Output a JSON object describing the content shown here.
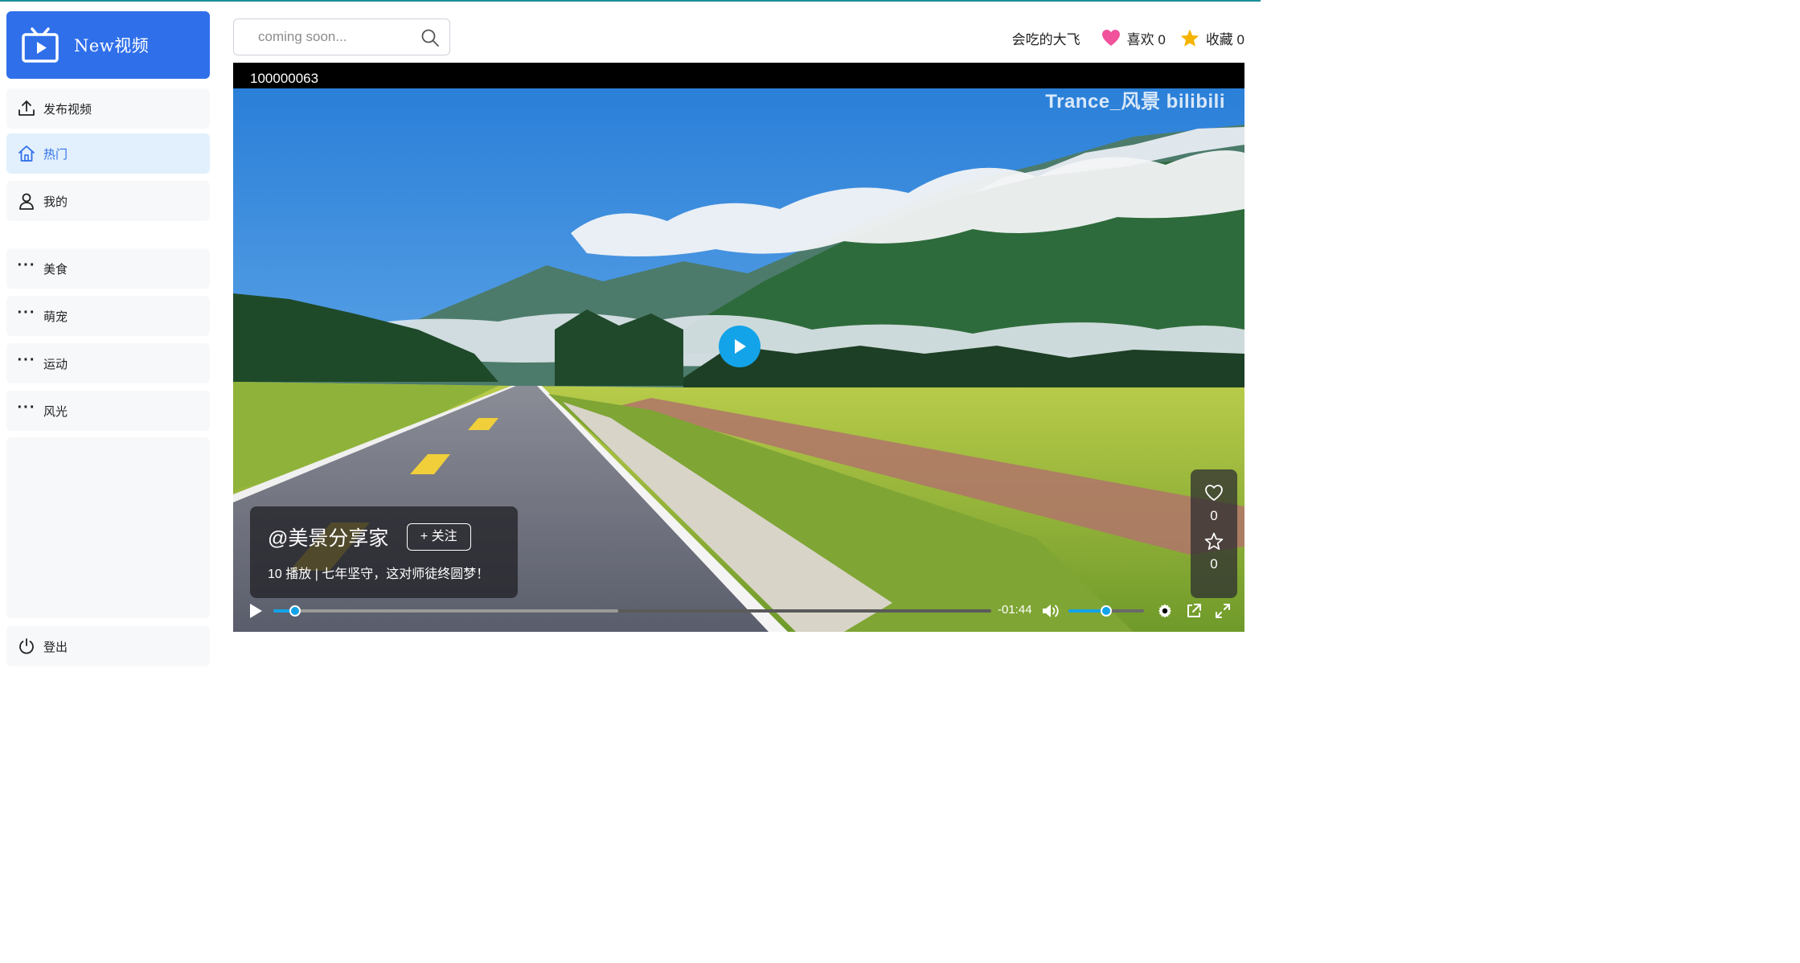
{
  "app": {
    "name": "New视频",
    "accent_color": "#2f6fea"
  },
  "sidebar": {
    "items": [
      {
        "label": "发布视频",
        "icon": "upload-icon"
      },
      {
        "label": "热门",
        "icon": "home-icon",
        "active": true
      },
      {
        "label": "我的",
        "icon": "user-icon"
      },
      {
        "label": "美食",
        "icon": "more-dots-icon"
      },
      {
        "label": "萌宠",
        "icon": "more-dots-icon"
      },
      {
        "label": "运动",
        "icon": "more-dots-icon"
      },
      {
        "label": "风光",
        "icon": "more-dots-icon"
      }
    ],
    "logout": {
      "label": "登出",
      "icon": "power-icon"
    }
  },
  "header": {
    "search": {
      "placeholder": "coming soon...",
      "value": ""
    },
    "username": "会吃的大飞",
    "likes_label": "喜欢 0",
    "favorites_label": "收藏 0",
    "like_color": "#f0529c",
    "star_color": "#f5b301"
  },
  "player": {
    "video_id": "100000063",
    "watermark": "Trance_风景 bilibili",
    "author": "@美景分享家",
    "follow_label": "+ 关注",
    "description": "10 播放 | 七年坚守，这对师徒终圆梦！",
    "like_count": "0",
    "favorite_count": "0",
    "time_remaining": "-01:44",
    "progress": 0.03,
    "buffered": 0.48,
    "volume": 0.5,
    "accent_color": "#13a3e8"
  }
}
